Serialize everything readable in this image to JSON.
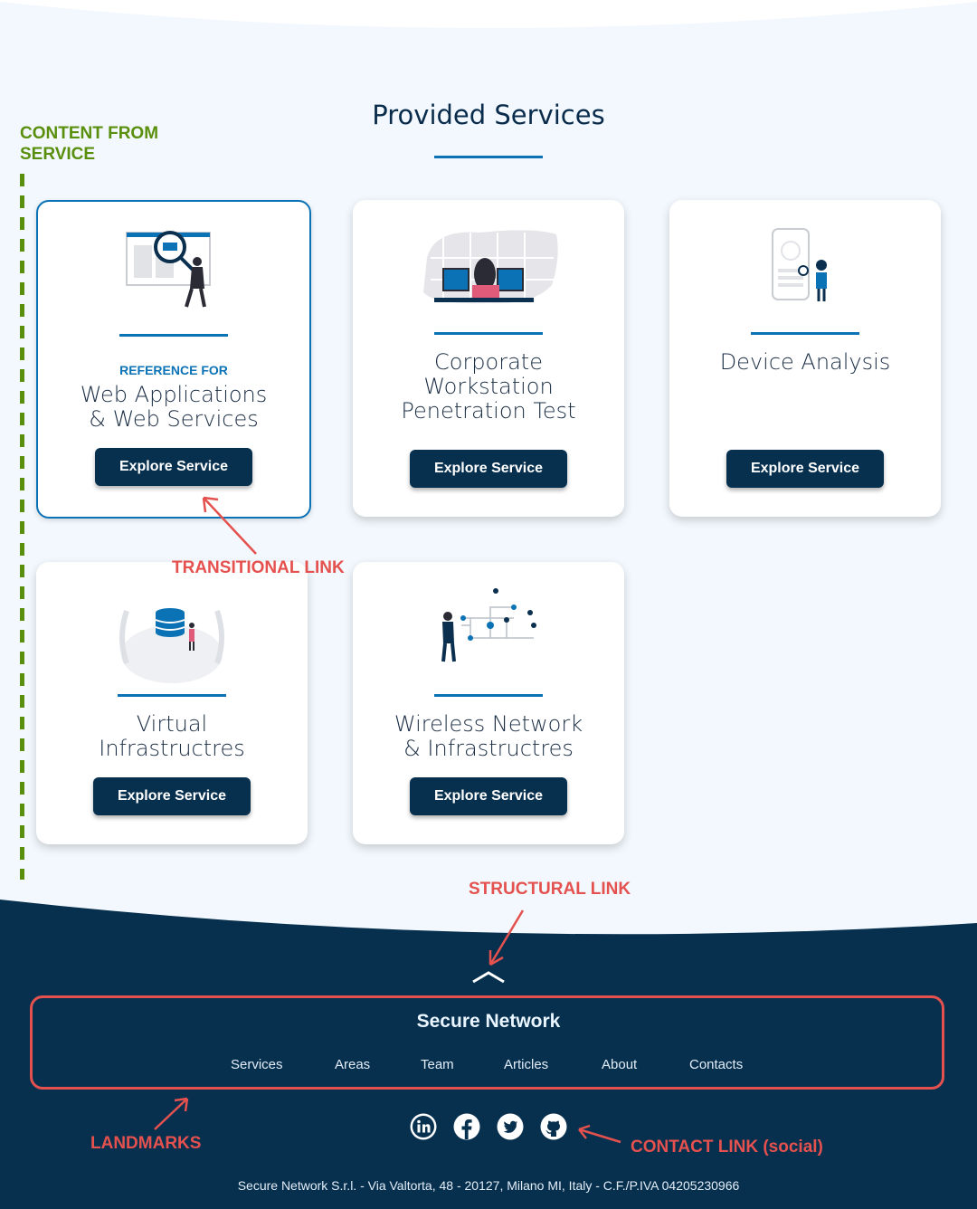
{
  "page": {
    "title": "Provided Services"
  },
  "annotations": {
    "content_from_service": "CONTENT FROM SERVICE",
    "transitional_link": "TRANSITIONAL LINK",
    "structural_link": "STRUCTURAL LINK",
    "landmarks": "LANDMARKS",
    "contact_link": "CONTACT LINK (social)"
  },
  "cards": [
    {
      "ref_label": "REFERENCE FOR",
      "title_lines": [
        "Web Applications",
        "& Web Services"
      ],
      "button": "Explore Service",
      "icon": "web-app-magnifier-illustration"
    },
    {
      "title_lines": [
        "Corporate",
        "Workstation",
        "Penetration Test"
      ],
      "button": "Explore Service",
      "icon": "workstation-illustration"
    },
    {
      "title_lines": [
        "Device Analysis"
      ],
      "button": "Explore Service",
      "icon": "mobile-device-illustration"
    },
    {
      "title_lines": [
        "Virtual",
        "Infrastructres"
      ],
      "button": "Explore Service",
      "icon": "database-illustration"
    },
    {
      "title_lines": [
        "Wireless Network",
        "& Infrastructres"
      ],
      "button": "Explore Service",
      "icon": "network-illustration"
    }
  ],
  "footer": {
    "brand": "Secure Network",
    "nav": [
      "Services",
      "Areas",
      "Team",
      "Articles",
      "About",
      "Contacts"
    ],
    "social": [
      "linkedin-icon",
      "facebook-icon",
      "twitter-icon",
      "github-icon"
    ],
    "address": "Secure Network S.r.l. - Via Valtorta, 48 - 20127, Milano MI, Italy - C.F./P.IVA 04205230966",
    "scroll_top_icon": "chevron-up-icon"
  },
  "colors": {
    "accent": "#0b72b5",
    "navy": "#07304f",
    "footer": "#07304f",
    "annotation_red": "#e4514e",
    "annotation_green": "#5a8f0e",
    "background": "#f2f8fd"
  }
}
